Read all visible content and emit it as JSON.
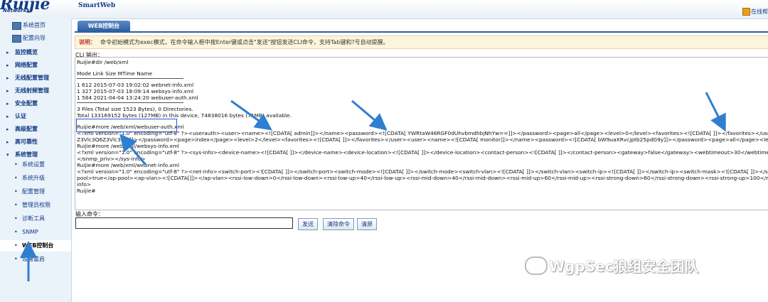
{
  "header": {
    "logo": "Ruijie",
    "logo_sub": "Networks",
    "brand": "SmartWeb",
    "help": "在线帮助"
  },
  "sidebar": {
    "top_items": [
      {
        "label": "系统首页",
        "icon": "home-icon"
      },
      {
        "label": "配置向导",
        "icon": "wizard-icon"
      }
    ],
    "groups": [
      {
        "label": "监控概览"
      },
      {
        "label": "网络配置"
      },
      {
        "label": "无线配置管理"
      },
      {
        "label": "无线射频管理"
      },
      {
        "label": "安全配置"
      },
      {
        "label": "认证"
      },
      {
        "label": "高级配置"
      },
      {
        "label": "高可靠性"
      },
      {
        "label": "系统管理"
      }
    ],
    "sub_items": [
      {
        "label": "系统设置"
      },
      {
        "label": "系统升级"
      },
      {
        "label": "配置管理"
      },
      {
        "label": "管理员权限"
      },
      {
        "label": "诊断工具"
      },
      {
        "label": "SNMP"
      },
      {
        "label": "WEB控制台"
      },
      {
        "label": "设备重启"
      }
    ],
    "active": "WEB控制台"
  },
  "main": {
    "tab": "WEB控制台",
    "notice_tag": "说明：",
    "notice": "命令初始模式为exec模式，在命令输入框中按Enter键或点击\"发送\"按钮发送CLI命令，支持Tab键和?号自动提醒。",
    "cli_label": "CLI 输出：",
    "cli_lines": [
      "Ruijie#dir /web/xml",
      "",
      "Mode Link     Size              MTime Name",
      "",
      "1       612 2015-07-03 19:02:02 webnet-info.xml",
      "1       327 2015-07-03 18:09:14 websys-info.xml",
      "1       584 2021-04-04 13:24:20 webuser-auth.xml",
      "",
      "3 Files (Total size 1523 Bytes), 0 Directories.",
      "Total 133169152 bytes (127MB) in this device, 74838016 bytes (71MB) available.",
      "",
      "Ruijie#more /web/xml/webuser-auth.xml",
      "<?xml version=\"1.0\" encoding=\"utf-8\" ?><userauth><user><name><![CDATA[   admin]]></name><password><![CDATA[   YWRtaW46RGF0dUhvbmdhbjNhYw==]]></password><page>all</page><level>0</level><favorites><![CDATA[   ]]></favorites></user><user><name><![CDATA[   guest]]></name><p",
      "Z3Vlc3Q6Z3Vlc3Q=]]></password><page>index</page><level>2</level><favorites><![CDATA[   ]]></favorites></user><user><name><![CDATA[   monitor]]></name><password><![CDATA[   bW9uaXRvcjptb25pdG9y]]></password><page>all</page><level>1</level><favorites><![CDATA[   ]]></favorites><",
      "Ruijie#more /web/xml/websys-info.xml",
      "<?xml version=\"1.0\" encoding=\"utf-8\" ?><sys-info><device-name><![CDATA[   ]]></device-name><device-location><![CDATA[   ]]></device-location><contact-person><![CDATA[   ]]></contact-person><gateway>false</gateway><webtimeout>30</webtimeout><firstlogin>false</firstlogin><snmp_auth></sn",
      "</snmp_priv></sys-info>",
      "Ruijie#more /web/xml/webnet-info.xml",
      "<?xml version=\"1.0\" encoding=\"utf-8\" ?><net-info><switch-port><![CDATA[   ]]></switch-port><switch-mode><![CDATA[   ]]></switch-mode><switch-vlan><![CDATA[   ]]></switch-vlan><switch-ip><![CDATA[   ]]></switch-ip><switch-mask><![CDATA[   ]]></switch-mask><switch-route><![CDATA[   ]]></switch-route><ap-",
      "pool>true</ap-pool><ap-vlan><![CDATA[]]></ap-vlan><rssi-low-down>0</rssi-low-down><rssi-low-up>40</rssi-low-up><rssi-mid-down>40</rssi-mid-down><rssi-mid-up>60</rssi-mid-up><rssi-strong-down>60</rssi-strong-down><rssi-strong-up>100</rssi-strong-up><ap-low-up>50</ap-low-up><ap-mid-up",
      "info>",
      "Ruijie#"
    ],
    "input_label": "输入命令：",
    "input_value": "",
    "buttons": {
      "send": "发送",
      "clear_cmd": "清除命令",
      "clear_screen": "清屏"
    }
  },
  "watermark": "WgpSec狼组安全团队",
  "colors": {
    "accent": "#2e5ea0",
    "annotation": "#2f7fd0",
    "highlight_box": "#2255d6"
  }
}
